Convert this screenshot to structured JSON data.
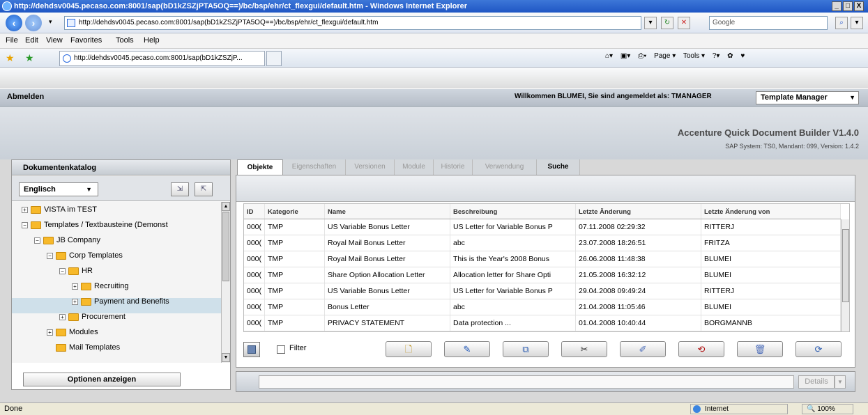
{
  "window": {
    "title": "http://dehdsv0045.pecaso.com:8001/sap(bD1kZSZjPTA5OQ==)/bc/bsp/ehr/ct_flexgui/default.htm - Windows Internet Explorer",
    "min": "_",
    "max": "□",
    "close": "X"
  },
  "address": {
    "url": "http://dehdsv0045.pecaso.com:8001/sap(bD1kZSZjPTA5OQ==)/bc/bsp/ehr/ct_flexgui/default.htm",
    "search_placeholder": "Google"
  },
  "menu": [
    "File",
    "Edit",
    "View",
    "Favorites",
    "Tools",
    "Help"
  ],
  "fav_tab": "http://dehdsv0045.pecaso.com:8001/sap(bD1kZSZjP...",
  "ie_tools": [
    "Page ▾",
    "Tools ▾"
  ],
  "sap": {
    "logout": "Abmelden",
    "welcome": "Willkommen BLUMEI, Sie sind angemeldet als: TMANAGER",
    "role": "Template Manager",
    "app_title": "Accenture Quick Document Builder V1.4.0",
    "app_sub": "SAP System: TS0, Mandant: 099, Version: 1.4.2"
  },
  "left": {
    "header": "Dokumentenkatalog",
    "language": "Englisch",
    "options_btn": "Optionen anzeigen",
    "tree": [
      {
        "label": "VISTA im TEST",
        "level": 0,
        "exp": "+"
      },
      {
        "label": "Templates / Textbausteine (Demonst",
        "level": 0,
        "exp": "−"
      },
      {
        "label": "JB Company",
        "level": 1,
        "exp": "−"
      },
      {
        "label": "Corp Templates",
        "level": 2,
        "exp": "−"
      },
      {
        "label": "HR",
        "level": 3,
        "exp": "−"
      },
      {
        "label": "Recruiting",
        "level": 4,
        "exp": "+"
      },
      {
        "label": "Payment and Benefits",
        "level": 4,
        "exp": "+"
      },
      {
        "label": "Procurement",
        "level": 3,
        "exp": "+"
      },
      {
        "label": "Modules",
        "level": 2,
        "exp": "+"
      },
      {
        "label": "Mail Templates",
        "level": 2,
        "exp": ""
      }
    ]
  },
  "tabs": [
    "Objekte",
    "Eigenschaften",
    "Versionen",
    "Module",
    "Historie",
    "Verwendung",
    "Suche"
  ],
  "table": {
    "headers": [
      "ID",
      "Kategorie",
      "Name",
      "Beschreibung",
      "Letzte Änderung",
      "Letzte Änderung von"
    ],
    "rows": [
      [
        "000(",
        "TMP",
        "US Variable Bonus Letter",
        "US Letter for Variable Bonus P",
        "07.11.2008 02:29:32",
        "RITTERJ"
      ],
      [
        "000(",
        "TMP",
        "Royal Mail Bonus Letter",
        "abc",
        "23.07.2008 18:26:51",
        "FRITZA"
      ],
      [
        "000(",
        "TMP",
        "Royal Mail Bonus Letter",
        "This is the Year's 2008 Bonus",
        "26.06.2008 11:48:38",
        "BLUMEI"
      ],
      [
        "000(",
        "TMP",
        "Share Option Allocation Letter",
        "Allocation letter for Share Opti",
        "21.05.2008 16:32:12",
        "BLUMEI"
      ],
      [
        "000(",
        "TMP",
        "US Variable Bonus Letter",
        "US Letter for Variable Bonus P",
        "29.04.2008 09:49:24",
        "RITTERJ"
      ],
      [
        "000(",
        "TMP",
        "Bonus Letter",
        "abc",
        "21.04.2008 11:05:46",
        "BLUMEI"
      ],
      [
        "000(",
        "TMP",
        "PRIVACY STATEMENT",
        "Data protection ...",
        "01.04.2008 10:40:44",
        "BORGMANNB"
      ]
    ]
  },
  "actions": {
    "filter": "Filter",
    "details": "Details"
  },
  "status": {
    "done": "Done",
    "zone": "Internet",
    "zoom": "100%"
  }
}
